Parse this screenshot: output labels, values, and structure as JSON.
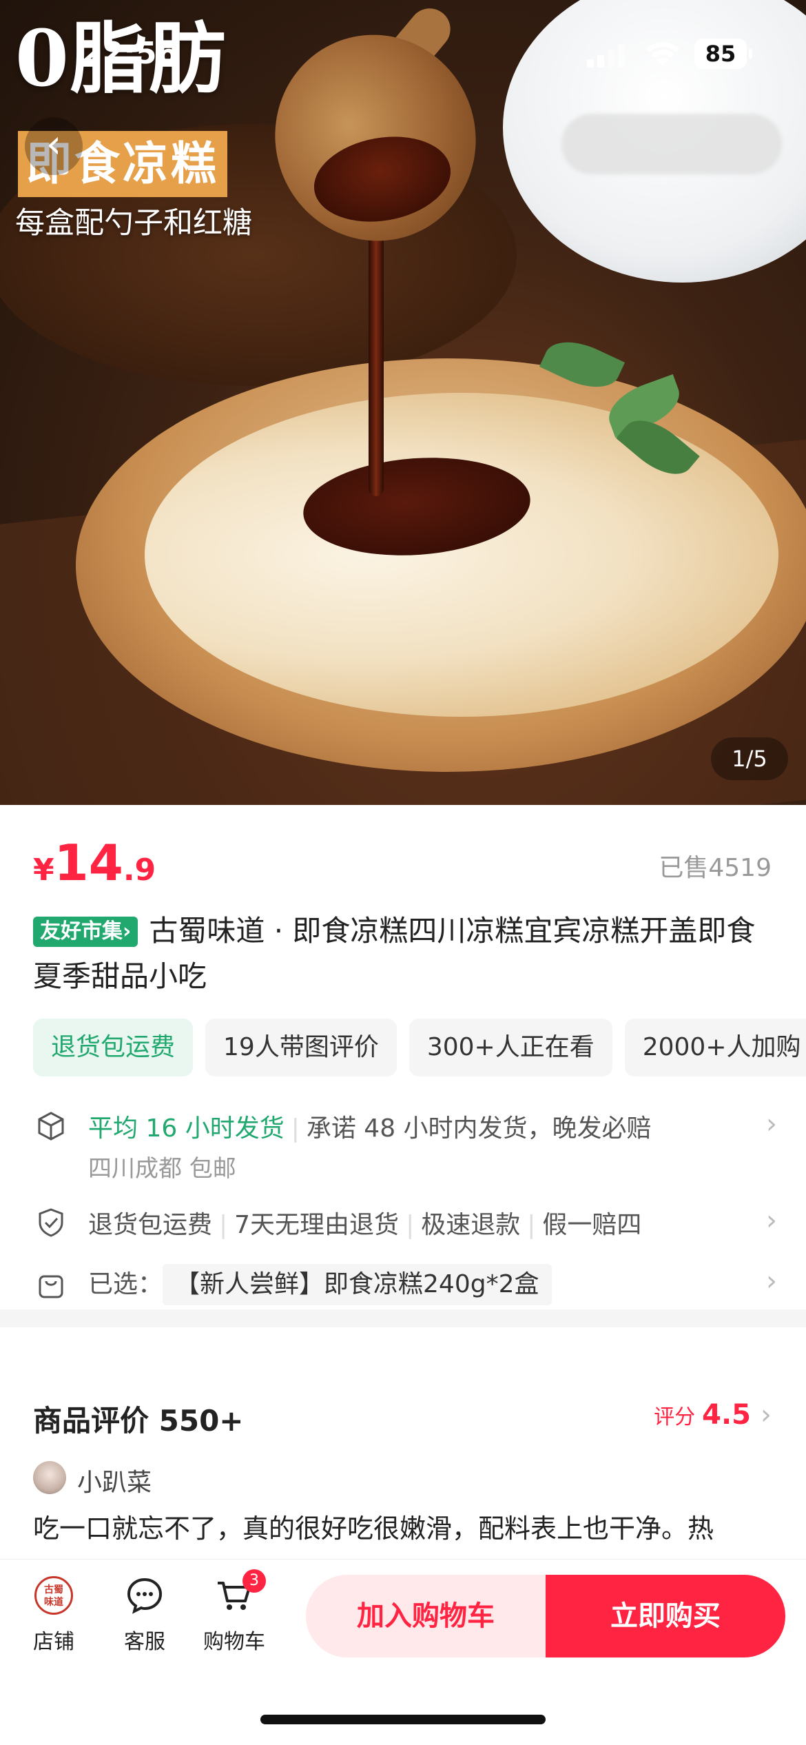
{
  "status_bar": {
    "time": "22:56",
    "battery": "85"
  },
  "hero": {
    "promo_title": "0脂肪",
    "promo_tag": "即食凉糕",
    "promo_sub": "每盒配勺子和红糖",
    "image_counter": "1/5"
  },
  "price": {
    "currency": "¥",
    "integer": "14",
    "decimal": ".9",
    "sold": "已售4519"
  },
  "product": {
    "market_tag": "友好市集›",
    "title": "古蜀味道 · 即食凉糕四川凉糕宜宾凉糕开盖即食夏季甜品小吃"
  },
  "chips": [
    "退货包运费",
    "19人带图评价",
    "300+人正在看",
    "2000+人加购"
  ],
  "shipping": {
    "highlight": "平均 16 小时发货",
    "promise": "承诺 48 小时内发货，晚发必赔",
    "origin": "四川成都 包邮"
  },
  "guarantees": [
    "退货包运费",
    "7天无理由退货",
    "极速退款",
    "假一赔四"
  ],
  "selection": {
    "label": "已选：",
    "value": "【新人尝鲜】即食凉糕240g*2盒"
  },
  "reviews": {
    "title": "商品评价 550+",
    "rating_label": "评分",
    "rating_value": "4.5",
    "reviewer_name": "小趴菜",
    "review_text": "吃一口就忘不了，真的很好吃很嫩滑，配料表上也干净。热"
  },
  "bottom_bar": {
    "shop_logo_text": "古蜀味道",
    "shop_label": "店铺",
    "service_label": "客服",
    "cart_label": "购物车",
    "cart_count": "3",
    "add_to_cart": "加入购物车",
    "buy_now": "立即购买"
  },
  "colors": {
    "accent": "#ff2442",
    "green": "#21a86f"
  }
}
